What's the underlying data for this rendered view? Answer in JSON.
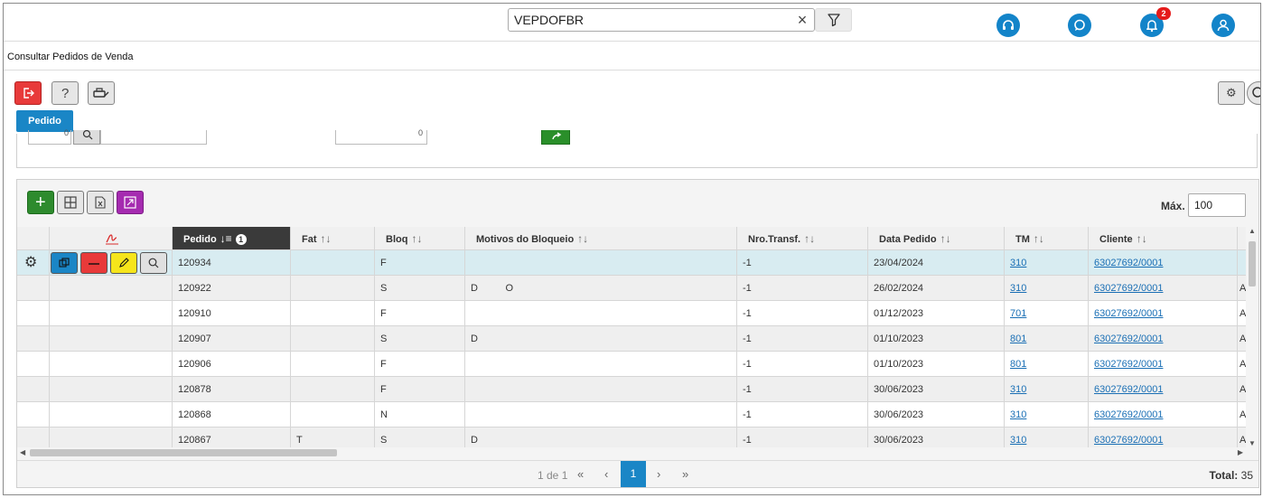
{
  "header": {
    "search_value": "VEPDOFBR",
    "notifications_count": "2",
    "colors": {
      "accent": "#1384c9",
      "badge": "#e51b1b"
    }
  },
  "page": {
    "title": "Consultar Pedidos de Venda"
  },
  "toolbar": {
    "tab_label": "Pedido"
  },
  "filter": {
    "field1_value": "0",
    "field2_value": "0"
  },
  "grid": {
    "max_label": "Máx.",
    "max_value": "100",
    "columns": [
      "Pedido",
      "Fat",
      "Bloq",
      "Motivos do Bloqueio",
      "Nro.Transf.",
      "Data Pedido",
      "TM",
      "Cliente"
    ],
    "sort_badge": "1",
    "rows": [
      {
        "pedido": "120934",
        "fat": "",
        "bloq": "F",
        "motivos": "",
        "transf": "-1",
        "data": "23/04/2024",
        "tm": "310",
        "cliente": "63027692/0001",
        "extra": ""
      },
      {
        "pedido": "120922",
        "fat": "",
        "bloq": "S",
        "motivos": "D          O",
        "transf": "-1",
        "data": "26/02/2024",
        "tm": "310",
        "cliente": "63027692/0001",
        "extra": "A"
      },
      {
        "pedido": "120910",
        "fat": "",
        "bloq": "F",
        "motivos": "",
        "transf": "-1",
        "data": "01/12/2023",
        "tm": "701",
        "cliente": "63027692/0001",
        "extra": "A"
      },
      {
        "pedido": "120907",
        "fat": "",
        "bloq": "S",
        "motivos": "D",
        "transf": "-1",
        "data": "01/10/2023",
        "tm": "801",
        "cliente": "63027692/0001",
        "extra": "A"
      },
      {
        "pedido": "120906",
        "fat": "",
        "bloq": "F",
        "motivos": "",
        "transf": "-1",
        "data": "01/10/2023",
        "tm": "801",
        "cliente": "63027692/0001",
        "extra": "A"
      },
      {
        "pedido": "120878",
        "fat": "",
        "bloq": "F",
        "motivos": "",
        "transf": "-1",
        "data": "30/06/2023",
        "tm": "310",
        "cliente": "63027692/0001",
        "extra": "A"
      },
      {
        "pedido": "120868",
        "fat": "",
        "bloq": "N",
        "motivos": "",
        "transf": "-1",
        "data": "30/06/2023",
        "tm": "310",
        "cliente": "63027692/0001",
        "extra": "A"
      },
      {
        "pedido": "120867",
        "fat": "T",
        "bloq": "S",
        "motivos": "D",
        "transf": "-1",
        "data": "30/06/2023",
        "tm": "310",
        "cliente": "63027692/0001",
        "extra": "A"
      }
    ]
  },
  "pagination": {
    "page_text": "1 de 1",
    "first": "«",
    "prev": "‹",
    "current": "1",
    "next": "›",
    "last": "»",
    "total_label": "Total:",
    "total_value": "35"
  }
}
